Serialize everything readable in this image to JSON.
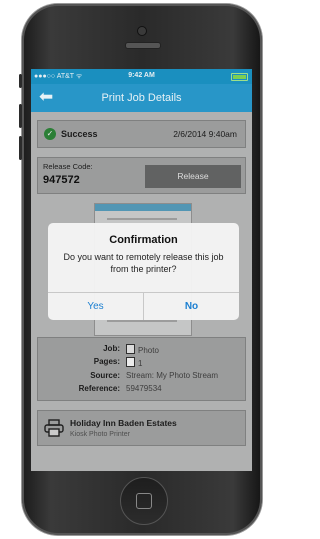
{
  "status_bar": {
    "carrier": "●●●○○ AT&T ᯤ",
    "time": "9:42 AM"
  },
  "nav": {
    "back_icon": "back-arrow-icon",
    "back_glyph": "⬅",
    "title": "Print Job Details"
  },
  "status": {
    "label": "Success",
    "date": "2/6/2014 9:40am",
    "icon": "check-icon",
    "icon_glyph": "✓"
  },
  "release": {
    "label": "Release Code:",
    "code": "947572",
    "button": "Release"
  },
  "dialog": {
    "title": "Confirmation",
    "message": "Do you want to remotely release this job from the printer?",
    "yes": "Yes",
    "no": "No"
  },
  "details": {
    "job_label": "Job:",
    "job_value": "Photo",
    "pages_label": "Pages:",
    "pages_value": "1",
    "source_label": "Source:",
    "source_value": "Stream: My Photo Stream",
    "reference_label": "Reference:",
    "reference_value": "59479534"
  },
  "printer": {
    "name": "Holiday Inn Baden Estates",
    "subtitle": "Kiosk Photo Printer"
  },
  "colors": {
    "accent": "#2896c8",
    "success": "#2f8a3b",
    "dialog_button": "#1b7fd1"
  }
}
